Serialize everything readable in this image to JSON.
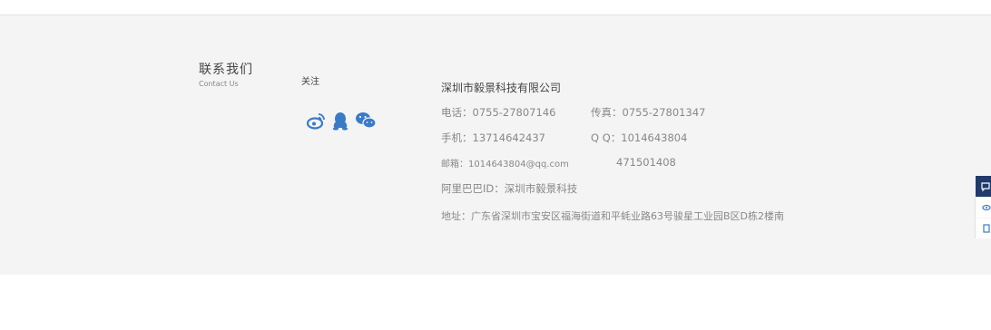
{
  "contact": {
    "title": "联系我们",
    "subtitle": "Contact Us"
  },
  "follow": {
    "label": "关注",
    "icons": [
      "weibo-icon",
      "qq-icon",
      "wechat-icon"
    ]
  },
  "company": {
    "name": "深圳市毅景科技有限公司",
    "phone": "电话：0755-27807146",
    "fax": "传真：0755-27801347",
    "mobile": "手机：13714642437",
    "qq": "Q Q：1014643804",
    "email": "邮箱：1014643804@qq.com",
    "qq2": "471501408",
    "alibaba": "阿里巴巴ID：深圳市毅景科技",
    "address": "地址：广东省深圳市宝安区福海街道和平蚝业路63号骏星工业园B区D栋2楼南"
  },
  "colors": {
    "footer_bg": "#f4f4f4",
    "icon_blue": "#3a7bc8",
    "side_dark": "#1f3a6b"
  }
}
